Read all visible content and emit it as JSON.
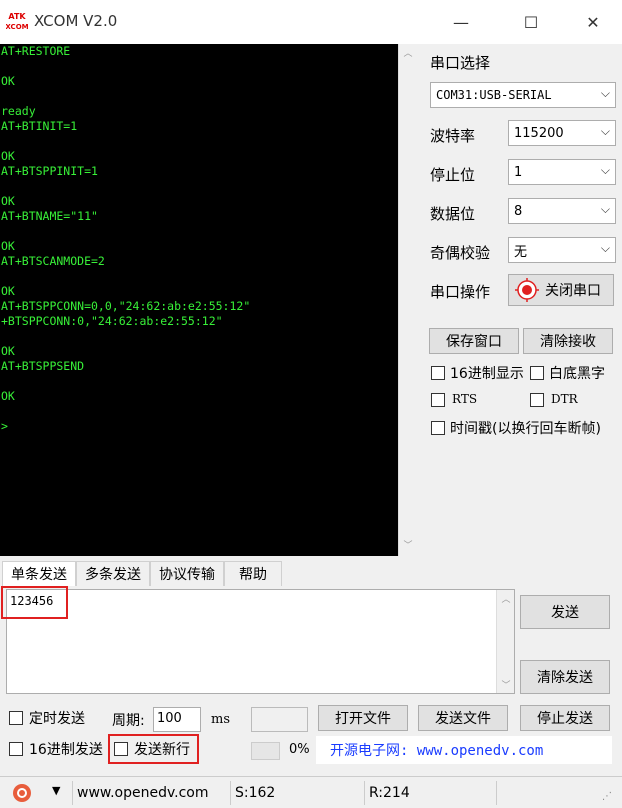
{
  "window": {
    "logo_text": "ATK XCOM",
    "title": "XCOM V2.0",
    "minimize_glyph": "—",
    "maximize_glyph": "☐",
    "close_glyph": "✕"
  },
  "console": {
    "text": "AT+RESTORE\n\nOK\n\nready\nAT+BTINIT=1\n\nOK\nAT+BTSPPINIT=1\n\nOK\nAT+BTNAME=\"11\"\n\nOK\nAT+BTSCANMODE=2\n\nOK\nAT+BTSPPCONN=0,0,\"24:62:ab:e2:55:12\"\n+BTSPPCONN:0,\"24:62:ab:e2:55:12\"\n\nOK\nAT+BTSPPSEND\n\nOK\n\n>",
    "text_color": "#38f038"
  },
  "serial": {
    "port_label": "串口选择",
    "port_value": "COM31:USB-SERIAL",
    "baud_label": "波特率",
    "baud_value": "115200",
    "stopbit_label": "停止位",
    "stopbit_value": "1",
    "databit_label": "数据位",
    "databit_value": "8",
    "parity_label": "奇偶校验",
    "parity_value": "无",
    "op_label": "串口操作",
    "op_button": "关闭串口",
    "save_window": "保存窗口",
    "clear_receive": "清除接收",
    "hex_display": "16进制显示",
    "white_black": "白底黑字",
    "rts": "RTS",
    "dtr": "DTR",
    "timestamp": "时间戳(以换行回车断帧)"
  },
  "tabs": [
    "单条发送",
    "多条发送",
    "协议传输",
    "帮助"
  ],
  "send": {
    "input_value": "123456",
    "send_button": "发送",
    "clear_send_button": "清除发送",
    "timed_send": "定时发送",
    "period_label": "周期:",
    "period_value": "100",
    "period_unit": "ms",
    "open_file": "打开文件",
    "send_file": "发送文件",
    "stop_send": "停止发送",
    "hex_send": "16进制发送",
    "send_newline": "发送新行",
    "progress": "0%",
    "banner": "开源电子网: www.openedv.com",
    "banner_color": "#1a3cff",
    "highlight_color": "#e02020"
  },
  "status": {
    "url": "www.openedv.com",
    "sent": "S:162",
    "received": "R:214"
  }
}
